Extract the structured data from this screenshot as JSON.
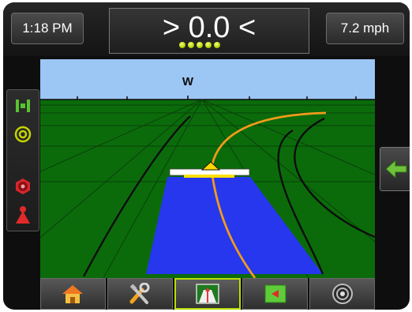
{
  "status_bar": {
    "time": "1:18 PM",
    "cross_track_error": "> 0.0 <",
    "speed": "7.2 mph",
    "guidance_leds_lit": 5
  },
  "map_view": {
    "compass_heading": "W",
    "sky_color": "#9cc6f4",
    "field_color": "#0b6b0b",
    "coverage_color": "#2637ee",
    "guideline_color": "#f29a1a"
  },
  "left_panel": {
    "buttons": [
      {
        "icon": "boom-section-icon"
      },
      {
        "icon": "target-icon"
      },
      {
        "icon": "section-control-icon"
      },
      {
        "icon": "cone-warning-icon"
      }
    ]
  },
  "right_panel": {
    "icon": "arrow-left-icon"
  },
  "bottom_tabs": [
    {
      "icon": "home-icon",
      "active": false
    },
    {
      "icon": "tools-icon",
      "active": false
    },
    {
      "icon": "vehicle-view-icon",
      "active": true
    },
    {
      "icon": "field-view-icon",
      "active": false
    },
    {
      "icon": "gnss-status-icon",
      "active": false
    }
  ]
}
